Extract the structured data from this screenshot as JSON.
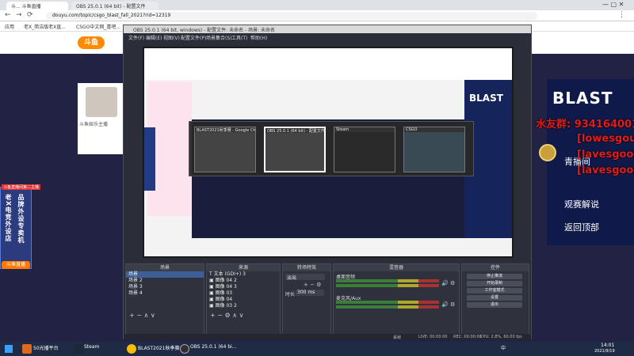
{
  "browser": {
    "tabs": [
      {
        "label": "斗... 斗鱼直播"
      },
      {
        "label": "OBS 25.0.1 (64 bit) - 配置文件"
      }
    ],
    "url": "douyu.com/topic/csgo_blast_fall_2021?rid=12319",
    "bookmarks": [
      "应用",
      "老X_简洁版老X直...",
      "CSGO中文网_喜吧..."
    ]
  },
  "page": {
    "logo": "斗鱼",
    "fan_count": "9",
    "streamer_badge": "斗鱼娱乐主播",
    "left_ad": {
      "badge": "斗鱼直播间第二主播",
      "col1": "老X电竞外设店",
      "col2": "品牌外设专卖机",
      "button": "斗鱼直播"
    },
    "blast_logo": "BLAST",
    "right_buttons": [
      "青播间",
      "观赛解说",
      "返回顶部"
    ],
    "danmaku": [
      "水友群: 934164001",
      "[lowesgouu]",
      "[lavesgoou]",
      "[lavesgoou]"
    ]
  },
  "obs": {
    "title": "OBS 25.0.1 (64 bit, windows) - 配置文件: 未命名 - 场景: 未命名",
    "menu": [
      "文件(F)",
      "编辑(E)",
      "视图(V)",
      "配置文件(P)",
      "场景集合(S)",
      "工具(T)",
      "帮助(H)"
    ],
    "switcher_windows": [
      "BLAST2021秋季赛 - Google Chrome",
      "OBS 25.0.1 (64 bit) - 配置文件",
      "Steam",
      "CSGO"
    ],
    "docks": {
      "scenes_title": "场景",
      "scenes": [
        "场景",
        "场景 2",
        "场景 3",
        "场景 4"
      ],
      "sources_title": "来源",
      "sources": [
        "文本 (GDI+) 3",
        "图像 04 2",
        "图像 04 3",
        "图像 03",
        "图像 04",
        "图像 03 2"
      ],
      "mixer_title": "混音器",
      "mixer_channels": [
        "桌面音频",
        "麦克风/Aux"
      ],
      "transition_title": "转场特效",
      "transition_value": "淡出",
      "transition_duration_label": "时长",
      "transition_duration": "300 ms",
      "controls_title": "控件",
      "controls": [
        "停止推流",
        "开始录制",
        "工作室模式",
        "设置",
        "退出"
      ]
    },
    "status": {
      "live": "LIVE: 00:00:00",
      "rec": "REC: 00:00:00",
      "cpu": "CPU: 2.8%, 60.00 fps",
      "dropped": "丢帧"
    }
  },
  "taskbar": {
    "items": [
      "50光播平台",
      "Steam",
      "BLAST2021秋季赛...",
      "OBS 25.0.1 (64 bi..."
    ],
    "clock_time": "14:01",
    "clock_date": "2021/9/19",
    "lang": "中"
  },
  "colors": {
    "accent": "#ff8a00",
    "danmaku_red": "#e21b1b",
    "obs_bg": "#2b2e38",
    "page_navy": "#222244"
  }
}
